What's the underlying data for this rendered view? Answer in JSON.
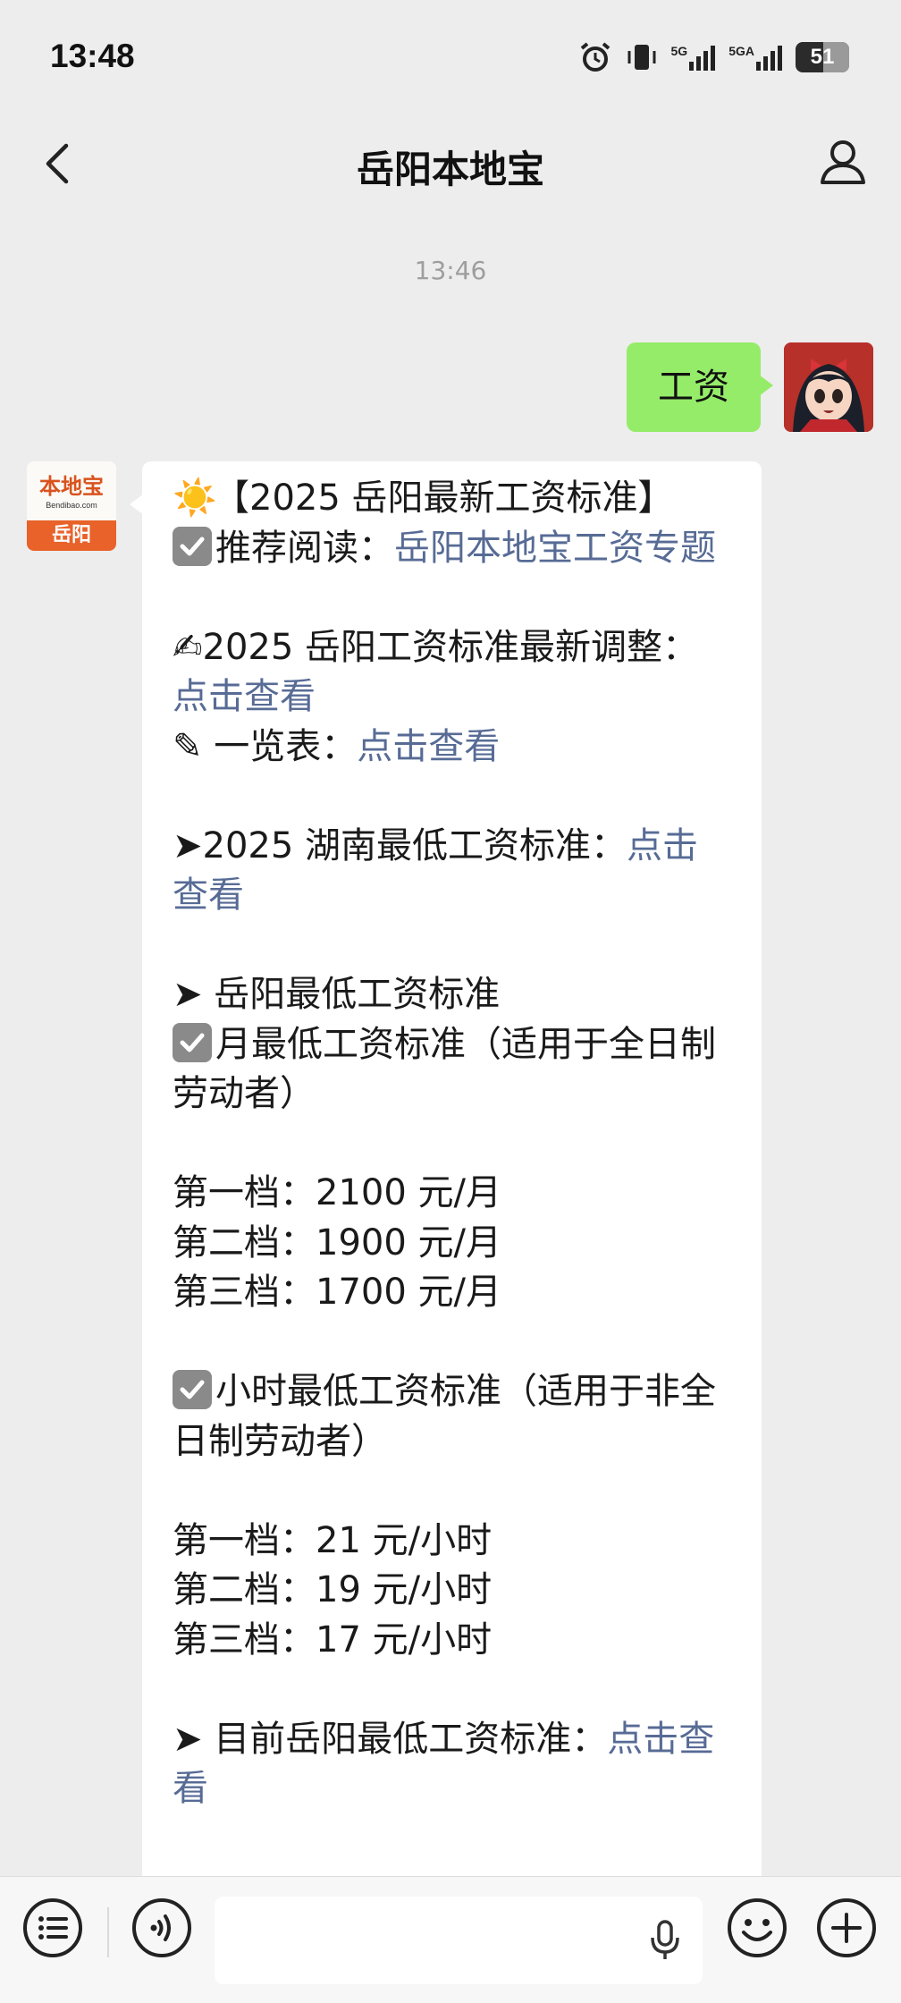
{
  "status_bar": {
    "time": "13:48",
    "network_1": "5G",
    "network_2": "5GA",
    "battery": "51",
    "battery_level_percent": 51
  },
  "nav": {
    "title": "岳阳本地宝"
  },
  "chat": {
    "timestamp": "13:46",
    "user_message": "工资",
    "bot_avatar": {
      "name": "本地宝",
      "sub": "Bendibao.com",
      "city": "岳阳"
    },
    "reply": {
      "l1": "【2025 岳阳最新工资标准】",
      "l2_text": "推荐阅读：",
      "l2_link": "岳阳本地宝工资专题",
      "l3_text": "2025 岳阳工资标准最新调整：",
      "l3_link": "点击查看",
      "l4_text": "一览表：",
      "l4_link": "点击查看",
      "l5_text": "2025 湖南最低工资标准：",
      "l5_link": "点击查看",
      "l6": "岳阳最低工资标准",
      "l7": "月最低工资标准（适用于全日制劳动者）",
      "monthly": [
        "第一档：2100 元/月",
        "第二档：1900 元/月",
        "第三档：1700 元/月"
      ],
      "l8": "小时最低工资标准（适用于非全日制劳动者）",
      "hourly": [
        "第一档：21 元/小时",
        "第二档：19 元/小时",
        "第三档：17 元/小时"
      ],
      "l9_text": "目前岳阳最低工资标准：",
      "l9_link": "点击查看"
    }
  },
  "icons": {
    "sun": "☀️",
    "writing_hand": "✍",
    "pencil": "✎",
    "arrow": "➤"
  },
  "colors": {
    "background": "#ededed",
    "user_bubble": "#95ec69",
    "link": "#576b95",
    "brand_orange": "#e8622a"
  }
}
